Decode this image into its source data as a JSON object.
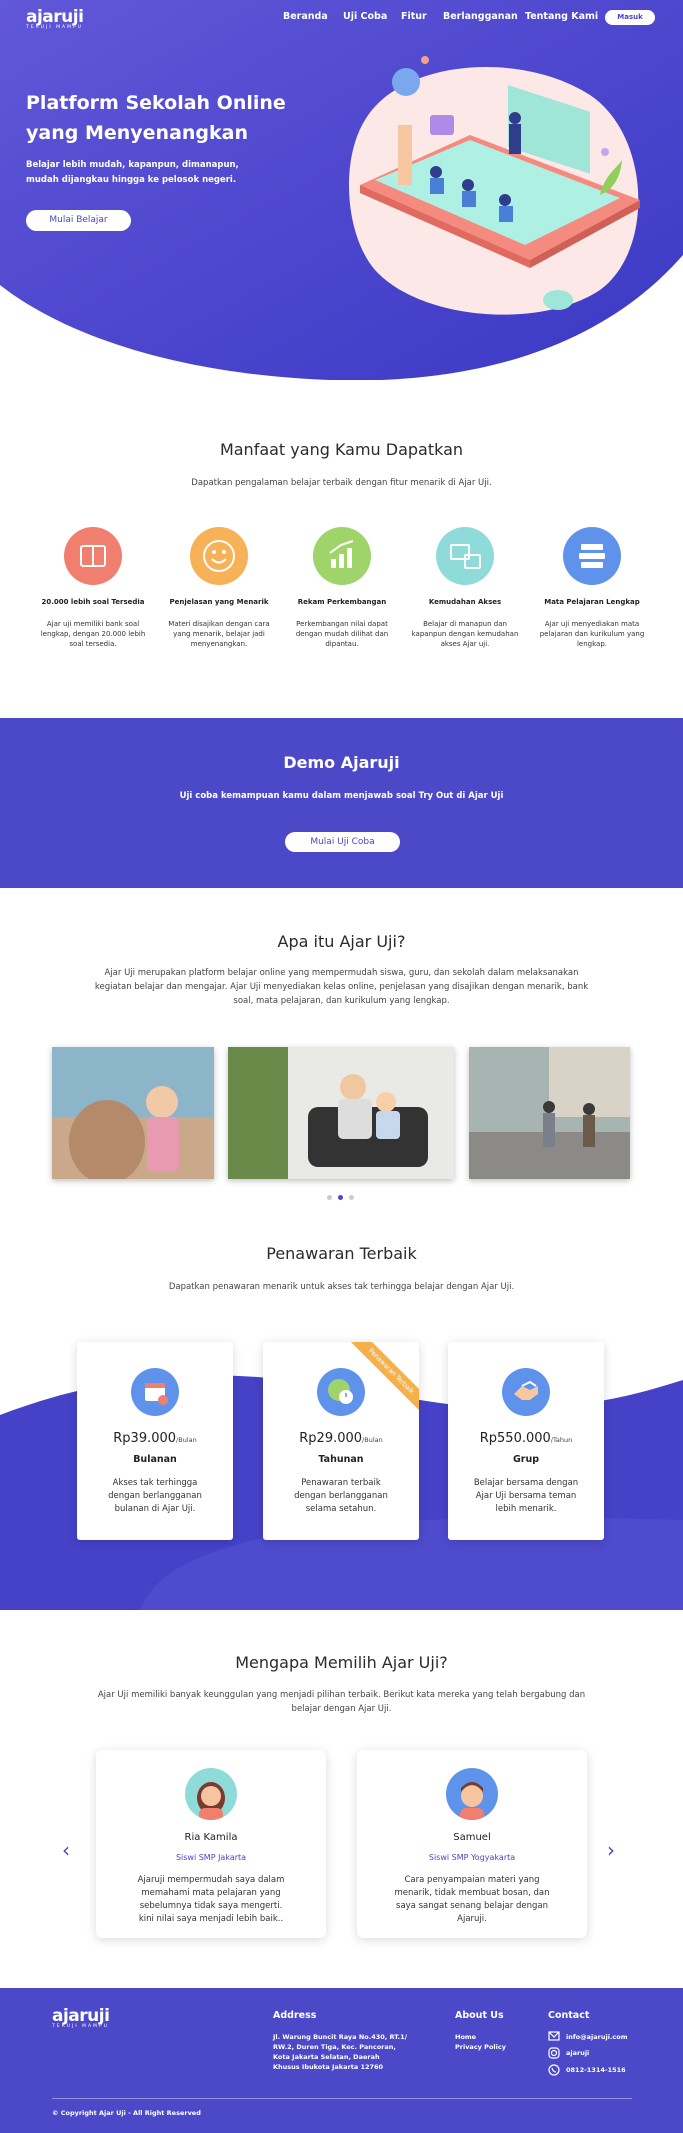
{
  "header": {
    "logo_word": "ajaruji",
    "logo_tag": "TERUJI MAMPU",
    "nav": [
      "Beranda",
      "Uji Coba",
      "Fitur",
      "Berlangganan",
      "Tentang Kami"
    ],
    "login_label": "Masuk"
  },
  "hero": {
    "title": "Platform Sekolah Online yang Menyenangkan",
    "subtitle": "Belajar lebih mudah, kapanpun, dimanapun, mudah dijangkau hingga ke pelosok negeri.",
    "cta_label": "Mulai Belajar"
  },
  "benefits": {
    "title": "Manfaat yang Kamu Dapatkan",
    "subtitle": "Dapatkan pengalaman belajar terbaik dengan fitur menarik di Ajar Uji.",
    "items": [
      {
        "title": "20.000 lebih soal Tersedia",
        "desc": "Ajar uji memiliki bank soal lengkap, dengan 20.000 lebih soal tersedia.",
        "color": "#f07f6f",
        "icon": "book-icon"
      },
      {
        "title": "Penjelasan yang Menarik",
        "desc": "Materi disajikan dengan cara yang menarik, belajar jadi menyenangkan.",
        "color": "#f7b257",
        "icon": "smile-icon"
      },
      {
        "title": "Rekam Perkembangan",
        "desc": "Perkembangan nilai dapat dengan mudah dilihat dan dipantau.",
        "color": "#9fd46b",
        "icon": "chart-icon"
      },
      {
        "title": "Kemudahan Akses",
        "desc": "Belajar di manapun dan kapanpun dengan kemudahan akses Ajar uji.",
        "color": "#8fdbd9",
        "icon": "devices-icon"
      },
      {
        "title": "Mata Pelajaran Lengkap",
        "desc": "Ajar uji menyediakan mata pelajaran dan kurikulum yang lengkap.",
        "color": "#5f92ea",
        "icon": "books-icon"
      }
    ]
  },
  "demo": {
    "title": "Demo Ajaruji",
    "subtitle": "Uji coba kemampuan kamu dalam menjawab soal Try Out di Ajar Uji",
    "cta_label": "Mulai Uji Coba"
  },
  "about": {
    "title": "Apa itu Ajar Uji?",
    "text": "Ajar Uji merupakan platform belajar online yang mempermudah siswa, guru, dan sekolah dalam melaksanakan kegiatan belajar dan mengajar. Ajar Uji menyediakan kelas online, penjelasan yang disajikan dengan menarik, bank soal, mata pelajaran, dan kurikulum yang lengkap."
  },
  "pricing": {
    "title": "Penawaran Terbaik",
    "subtitle": "Dapatkan penawaran menarik untuk akses tak terhingga belajar dengan Ajar Uji.",
    "plans": [
      {
        "price": "Rp39.000",
        "period": "/Bulan",
        "name": "Bulanan",
        "desc": "Akses tak terhingga dengan berlangganan bulanan di Ajar Uji.",
        "icon": "calendar-icon"
      },
      {
        "price": "Rp29.000",
        "period": "/Bulan",
        "name": "Tahunan",
        "desc": "Penawaran terbaik dengan berlangganan selama setahun.",
        "icon": "globe-clock-icon",
        "ribbon": "Penawaran Terbaik"
      },
      {
        "price": "Rp550.000",
        "period": "/Tahun",
        "name": "Grup",
        "desc": "Belajar bersama dengan Ajar Uji bersama teman lebih menarik.",
        "icon": "handshake-icon"
      }
    ]
  },
  "why": {
    "title": "Mengapa Memilih Ajar Uji?",
    "subtitle": "Ajar Uji memiliki banyak keunggulan yang menjadi pilihan terbaik. Berikut kata mereka yang telah bergabung dan belajar dengan Ajar Uji.",
    "testimonials": [
      {
        "name": "Ria Kamila",
        "school": "Siswi SMP Jakarta",
        "text": "Ajaruji mempermudah saya dalam memahami mata pelajaran yang sebelumnya tidak saya mengerti. kini nilai saya menjadi lebih baik.."
      },
      {
        "name": "Samuel",
        "school": "Siswi SMP Yogyakarta",
        "text": "Cara penyampaian materi yang menarik, tidak membuat bosan, dan saya sangat senang belajar dengan Ajaruji."
      }
    ]
  },
  "footer": {
    "address_title": "Address",
    "address": "Jl. Warung Buncit Raya No.430, RT.1/ RW.2, Duren Tiga, Kec. Pancoran, Kota Jakarta Selatan, Daerah Khusus Ibukota Jakarta 12760",
    "about_title": "About Us",
    "about_links": [
      "Home",
      "Privacy Policy"
    ],
    "contact_title": "Contact",
    "email": "info@ajaruji.com",
    "instagram": "ajaruji",
    "phone": "0812-1314-1516",
    "copyright": "© Copyright Ajar Uji - All Right Reserved"
  }
}
